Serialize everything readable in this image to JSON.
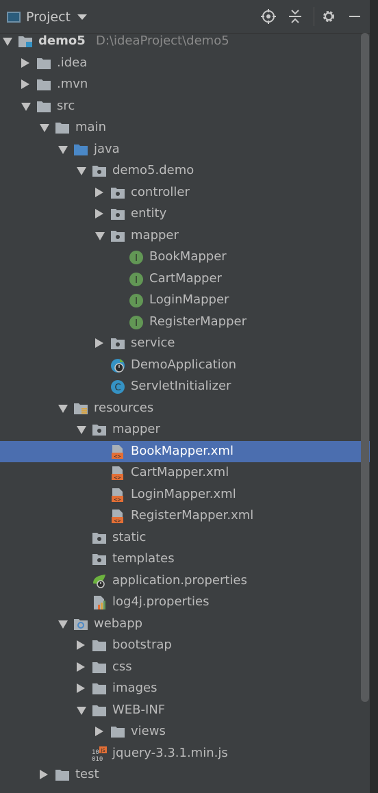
{
  "panel": {
    "title": "Project",
    "icons": [
      "crosshair-icon",
      "collapse-all-icon",
      "gear-icon",
      "minimize-icon"
    ]
  },
  "colors": {
    "background": "#3c3f41",
    "selection": "#4b6eaf",
    "folder": "#a9b0b6",
    "source_folder": "#4a88c7",
    "interface": "#629755",
    "class": "#3592c4",
    "xml": "#e36f36"
  },
  "tree": [
    {
      "label": "demo5",
      "path": "D:\\ideaProject\\demo5",
      "level": 0,
      "arrow": "expanded",
      "icon": "module-folder-icon",
      "bold": true
    },
    {
      "label": ".idea",
      "level": 1,
      "arrow": "collapsed",
      "icon": "folder-icon"
    },
    {
      "label": ".mvn",
      "level": 1,
      "arrow": "collapsed",
      "icon": "folder-icon"
    },
    {
      "label": "src",
      "level": 1,
      "arrow": "expanded",
      "icon": "folder-icon"
    },
    {
      "label": "main",
      "level": 2,
      "arrow": "expanded",
      "icon": "folder-icon"
    },
    {
      "label": "java",
      "level": 3,
      "arrow": "expanded",
      "icon": "source-folder-icon"
    },
    {
      "label": "demo5.demo",
      "level": 4,
      "arrow": "expanded",
      "icon": "package-icon"
    },
    {
      "label": "controller",
      "level": 5,
      "arrow": "collapsed",
      "icon": "package-icon"
    },
    {
      "label": "entity",
      "level": 5,
      "arrow": "collapsed",
      "icon": "package-icon"
    },
    {
      "label": "mapper",
      "level": 5,
      "arrow": "expanded",
      "icon": "package-icon"
    },
    {
      "label": "BookMapper",
      "level": 6,
      "arrow": "none",
      "icon": "interface-icon"
    },
    {
      "label": "CartMapper",
      "level": 6,
      "arrow": "none",
      "icon": "interface-icon"
    },
    {
      "label": "LoginMapper",
      "level": 6,
      "arrow": "none",
      "icon": "interface-icon"
    },
    {
      "label": "RegisterMapper",
      "level": 6,
      "arrow": "none",
      "icon": "interface-icon"
    },
    {
      "label": "service",
      "level": 5,
      "arrow": "collapsed",
      "icon": "package-icon"
    },
    {
      "label": "DemoApplication",
      "level": 5,
      "arrow": "none",
      "icon": "spring-boot-class-icon"
    },
    {
      "label": "ServletInitializer",
      "level": 5,
      "arrow": "none",
      "icon": "class-icon"
    },
    {
      "label": "resources",
      "level": 3,
      "arrow": "expanded",
      "icon": "resources-folder-icon"
    },
    {
      "label": "mapper",
      "level": 4,
      "arrow": "expanded",
      "icon": "package-icon"
    },
    {
      "label": "BookMapper.xml",
      "level": 5,
      "arrow": "none",
      "icon": "xml-file-icon",
      "selected": true
    },
    {
      "label": "CartMapper.xml",
      "level": 5,
      "arrow": "none",
      "icon": "xml-file-icon"
    },
    {
      "label": "LoginMapper.xml",
      "level": 5,
      "arrow": "none",
      "icon": "xml-file-icon"
    },
    {
      "label": "RegisterMapper.xml",
      "level": 5,
      "arrow": "none",
      "icon": "xml-file-icon"
    },
    {
      "label": "static",
      "level": 4,
      "arrow": "none",
      "icon": "package-icon"
    },
    {
      "label": "templates",
      "level": 4,
      "arrow": "none",
      "icon": "package-icon"
    },
    {
      "label": "application.properties",
      "level": 4,
      "arrow": "none",
      "icon": "spring-properties-icon"
    },
    {
      "label": "log4j.properties",
      "level": 4,
      "arrow": "none",
      "icon": "properties-file-icon"
    },
    {
      "label": "webapp",
      "level": 3,
      "arrow": "expanded",
      "icon": "web-folder-icon"
    },
    {
      "label": "bootstrap",
      "level": 4,
      "arrow": "collapsed",
      "icon": "folder-icon"
    },
    {
      "label": "css",
      "level": 4,
      "arrow": "collapsed",
      "icon": "folder-icon"
    },
    {
      "label": "images",
      "level": 4,
      "arrow": "collapsed",
      "icon": "folder-icon"
    },
    {
      "label": "WEB-INF",
      "level": 4,
      "arrow": "expanded",
      "icon": "folder-icon"
    },
    {
      "label": "views",
      "level": 5,
      "arrow": "collapsed",
      "icon": "folder-icon"
    },
    {
      "label": "jquery-3.3.1.min.js",
      "level": 4,
      "arrow": "none",
      "icon": "js-file-icon"
    },
    {
      "label": "test",
      "level": 2,
      "arrow": "collapsed",
      "icon": "folder-icon"
    }
  ]
}
